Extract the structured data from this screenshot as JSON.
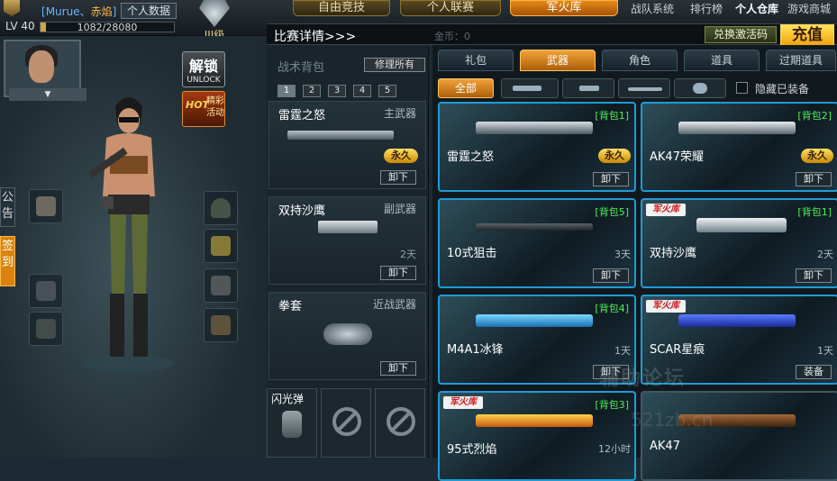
{
  "player": {
    "name": "Murue",
    "name_suffix": "赤焰",
    "personal_data": "个人数据",
    "level": "LV 40",
    "xp_text": "1082/28080",
    "xp_fraction": 0.04,
    "rank": "III级"
  },
  "main_tabs": [
    "自由竞技",
    "个人联赛",
    "军火库"
  ],
  "nav_links": [
    "战队系统",
    "排行榜",
    "个人仓库",
    "游戏商城"
  ],
  "match_bar": {
    "title": "比赛详情>>>",
    "gold": "金币：0",
    "redeem": "兑换激活码",
    "recharge": "充值"
  },
  "char_panel": {
    "unlock_cn": "解锁",
    "unlock_en": "UNLOCK",
    "hot_label": "HOT",
    "hot_text": "精彩活动",
    "side_tabs": [
      "公告",
      "签到"
    ]
  },
  "pack": {
    "title": "战术背包",
    "repair": "修理所有",
    "num_tabs": [
      "1",
      "2",
      "3",
      "4",
      "5"
    ],
    "primary": {
      "name": "雷霆之怒",
      "slot": "主武器",
      "status": "永久",
      "action": "卸下"
    },
    "secondary": {
      "name": "双持沙鹰",
      "slot": "副武器",
      "duration": "2天",
      "action": "卸下"
    },
    "melee": {
      "name": "拳套",
      "slot": "近战武器",
      "action": "卸下"
    },
    "throw": {
      "name": "闪光弹"
    }
  },
  "store": {
    "category_tabs": [
      "礼包",
      "武器",
      "角色",
      "道具",
      "过期道具"
    ],
    "sub_all": "全部",
    "hide_equipped": "隐藏已装备",
    "items": [
      {
        "pack": "[背包1]",
        "name": "雷霆之怒",
        "status": "永久",
        "action": "卸下"
      },
      {
        "pack": "[背包2]",
        "name": "AK47荣耀",
        "status": "永久",
        "action": "卸下"
      },
      {
        "pack": "[背包5]",
        "name": "10式狙击",
        "duration": "3天",
        "action": "卸下"
      },
      {
        "pack": "[背包1]",
        "name": "双持沙鹰",
        "duration": "2天",
        "action": "卸下",
        "badge": "军火库"
      },
      {
        "pack": "[背包4]",
        "name": "M4A1冰锋",
        "duration": "1天",
        "action": "卸下"
      },
      {
        "name": "SCAR星痕",
        "duration": "1天",
        "action": "装备",
        "badge": "军火库"
      },
      {
        "pack": "[背包3]",
        "name": "95式烈焰",
        "duration": "12小时",
        "badge": "军火库"
      },
      {
        "name": "AK47"
      }
    ]
  },
  "watermark": {
    "text1": "辅助论坛",
    "text2": "521zb.cn"
  }
}
